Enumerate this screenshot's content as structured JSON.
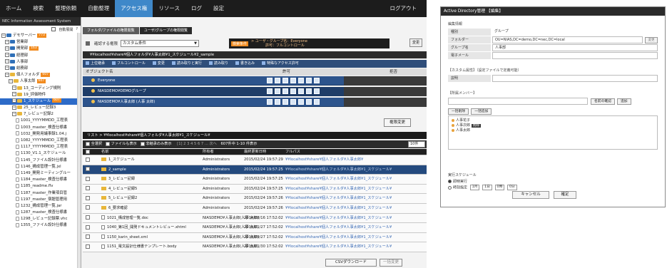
{
  "nav": {
    "items": [
      "ホーム",
      "検索",
      "整理依頼",
      "自動整理",
      "アクセス権",
      "リソース",
      "ログ",
      "設定"
    ],
    "active_index": 4,
    "logout": "ログアウト"
  },
  "sidebar": {
    "system_title": "NEC Information Assessment System",
    "auto_expand_label": "自動展開",
    "help": "?",
    "tree": [
      {
        "label": "デモサーバー",
        "badge": "773",
        "icon": "server"
      },
      {
        "label": "営業部",
        "badge": "",
        "icon": "server"
      },
      {
        "label": "開発部",
        "badge": "163",
        "icon": "server"
      },
      {
        "label": "経理部",
        "badge": "",
        "icon": "server"
      },
      {
        "label": "人事部",
        "badge": "",
        "icon": "server"
      },
      {
        "label": "総務部",
        "badge": "",
        "icon": "server"
      },
      {
        "label": "個人フォルダ",
        "badge": "607",
        "icon": "folder"
      },
      {
        "label": "人事太郎",
        "badge": "607",
        "icon": "folder"
      },
      {
        "label": "13_コーディング規則",
        "badge": "",
        "icon": "folder"
      },
      {
        "label": "19_評価物件",
        "badge": "",
        "icon": "folder"
      },
      {
        "label": "1_スケジュール",
        "badge": "607",
        "icon": "folder",
        "selected": true
      },
      {
        "label": "25_レビュー記録3",
        "badge": "",
        "icon": "folder"
      },
      {
        "label": "7_レビュー記録2",
        "badge": "",
        "icon": "folder"
      },
      {
        "label": "1001_YYYYMMDD_工程表",
        "badge": "",
        "icon": "file"
      },
      {
        "label": "1003_master_検査仕様書",
        "badge": "",
        "icon": "file"
      },
      {
        "label": "1032_開発用議事録1.04.j",
        "badge": "",
        "icon": "file"
      },
      {
        "label": "1082_YYYYMMDD_工程表",
        "badge": "",
        "icon": "file"
      },
      {
        "label": "1117_YYYYMMDD_工程表",
        "badge": "",
        "icon": "file"
      },
      {
        "label": "1130_V1.1_スケジュール",
        "badge": "",
        "icon": "file"
      },
      {
        "label": "1145_ファイル設計仕様書",
        "badge": "",
        "icon": "file"
      },
      {
        "label": "1146_構成管理一覧.jxl",
        "badge": "",
        "icon": "file"
      },
      {
        "label": "1149_開発ミーティングルー",
        "badge": "",
        "icon": "file"
      },
      {
        "label": "1184_master_検査仕様書",
        "badge": "",
        "icon": "file"
      },
      {
        "label": "1185_readme.flv",
        "badge": "",
        "icon": "file"
      },
      {
        "label": "1187_master_作業項目管",
        "badge": "",
        "icon": "file"
      },
      {
        "label": "1197_master_宿題管理用",
        "badge": "",
        "icon": "file"
      },
      {
        "label": "1232_構成管理一覧.jar",
        "badge": "",
        "icon": "file"
      },
      {
        "label": "1287_master_検査仕様書",
        "badge": "",
        "icon": "file"
      },
      {
        "label": "1298_レビュー記録票.vhc",
        "badge": "",
        "icon": "file"
      },
      {
        "label": "1355_ファイル設計仕様書",
        "badge": "",
        "icon": "file"
      }
    ]
  },
  "main": {
    "tabs": [
      "フォルダ/ファイルの権限閲覧",
      "ユーザ/グループの権限閲覧"
    ],
    "active_tab": 1,
    "target_label": "確認する権限",
    "target_value": "カスタム条件",
    "cond_tag": "検索条件",
    "cond_line1": "> ユーザ・グループ名：Everyone",
    "cond_line2": "許可：フルコントロール",
    "change_button": "変更",
    "path": "¥¥localhost¥share¥個人フォルダ¥人事太郎¥1_スケジュール¥2_sample",
    "toolbar": [
      "上位継承",
      "フルコントロール",
      "変更",
      "読み取りと実行",
      "読み取り",
      "書き込み",
      "特殊なアクセス許可"
    ],
    "perm_header": {
      "object": "オブジェクト名",
      "allow": "許可",
      "deny": "拒否"
    },
    "perm_rows": [
      "Everyone",
      "NIASDEMO¥DEMOグループ",
      "NIASDEMO¥人事太郎 (人事 太郎)"
    ],
    "perm_change_button": "権限変更",
    "list_path": "リスト >  ¥¥localhost¥share¥個人フォルダ¥人事太郎¥1_スケジュール¥",
    "filter_select_all": "全選択",
    "filter_show_files": "ファイルも表示",
    "filter_non_inherit": "非継承のみ表示",
    "pager": "[1]  2  3  4  5  6  7  ...  次へ",
    "count": "607件中 1-10 件表示",
    "per_page": "10件",
    "columns": [
      "名前",
      "所有者",
      "最終更新日時",
      "フルパス"
    ],
    "rows": [
      {
        "name": "1_スケジュール",
        "owner": "Administrators",
        "date": "2015/02/24 19:57:29",
        "path": "¥¥localhost¥share¥個人フォルダ¥人事太郎¥",
        "type": "folder"
      },
      {
        "name": "2_sample",
        "owner": "Administrators",
        "date": "2015/02/24 19:57:25",
        "path": "¥¥localhost¥share¥個人フォルダ¥人事太郎¥1_スケジュール¥",
        "type": "folder",
        "selected": true
      },
      {
        "name": "3_レビュー記録",
        "owner": "Administrators",
        "date": "2015/02/24 19:57:25",
        "path": "¥¥localhost¥share¥個人フォルダ¥人事太郎¥1_スケジュール¥",
        "type": "folder"
      },
      {
        "name": "4_レビュー記録5",
        "owner": "Administrators",
        "date": "2015/02/24 19:57:25",
        "path": "¥¥localhost¥share¥個人フォルダ¥人事太郎¥1_スケジュール¥",
        "type": "folder"
      },
      {
        "name": "5_レビュー記録2",
        "owner": "Administrators",
        "date": "2015/02/24 19:57:26",
        "path": "¥¥localhost¥share¥個人フォルダ¥人事太郎¥1_スケジュール¥",
        "type": "folder"
      },
      {
        "name": "6_要求確認",
        "owner": "Administrators",
        "date": "2015/02/24 19:57:26",
        "path": "¥¥localhost¥share¥個人フォルダ¥人事太郎¥1_スケジュール¥",
        "type": "folder"
      },
      {
        "name": "1021_構成管理一覧.doc",
        "owner": "NIASDEMO¥人事太郎(人事 太郎)",
        "date": "2014/08/16 17:52:02",
        "path": "¥¥localhost¥share¥個人フォルダ¥人事太郎¥1_スケジュール¥",
        "type": "file"
      },
      {
        "name": "1040_第1回_開発ドキュメントレビュー.xhtml",
        "owner": "NIASDEMO¥人事太郎(人事 太郎)",
        "date": "2015/01/27 17:52:02",
        "path": "¥¥localhost¥share¥個人フォルダ¥人事太郎¥1_スケジュール¥",
        "type": "file"
      },
      {
        "name": "1150_karin_sheet.xml",
        "owner": "NIASDEMO¥人事太郎(人事 太郎)",
        "date": "2013/09/27 17:52:02",
        "path": "¥¥localhost¥share¥個人フォルダ¥人事太郎¥1_スケジュール¥",
        "type": "file"
      },
      {
        "name": "1151_電文設計仕様書テンプレート.body",
        "owner": "NIASDEMO¥人事太郎(人事 太郎)",
        "date": "2015/01/30 17:52:02",
        "path": "¥¥localhost¥share¥個人フォルダ¥人事太郎¥1_スケジュール¥",
        "type": "file"
      }
    ],
    "csv_button": "CSVダウンロード",
    "bulk_button": "一括変更"
  },
  "dialog": {
    "title": "Active Directory管理 【編集】",
    "section_basic": "編集情報",
    "fields": [
      {
        "label": "種別",
        "value": "グループ"
      },
      {
        "label": "フォルダー",
        "value": "OU=NIAS,DC=demo,DC=nec,DC=local"
      },
      {
        "label": "グループ名",
        "value": "人事部"
      },
      {
        "label": "電子メール",
        "value": ""
      }
    ],
    "folder_button": "変更",
    "custom_label": "【カスタム属性】（設定ファイルで定義可能）",
    "desc_label": "説明",
    "member_label": "【所属メンバー】",
    "name_check": "名前の確認",
    "add": "追加",
    "bulk_delete": "一括削除",
    "bulk_add": "一括追加",
    "members": [
      "人事花子",
      "人事次郎",
      "人事太郎"
    ],
    "remove_tag": "削除",
    "schedule_label": "実行スケジュール",
    "immediate": "即時実行",
    "scheduled": "時刻指定",
    "month": "1月",
    "day": "1日",
    "hour": "0時",
    "minute": "0分",
    "cancel": "キャンセル",
    "confirm": "確定"
  }
}
